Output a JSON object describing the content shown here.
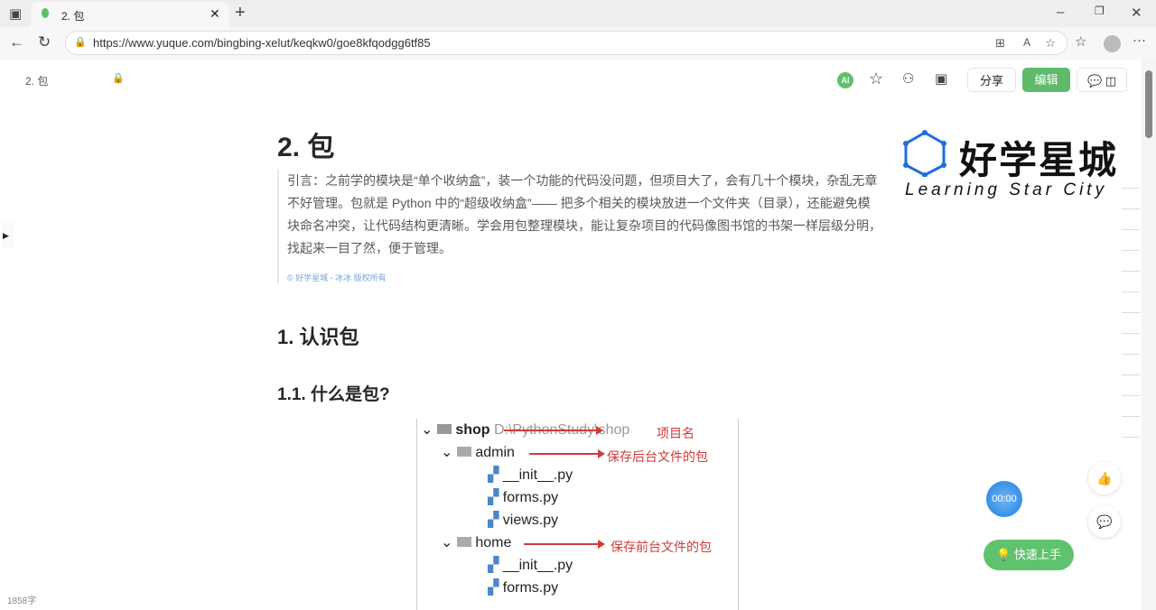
{
  "browser": {
    "tab_title": "2. 包",
    "url": "https://www.yuque.com/bingbing-xelut/keqkw0/goe8kfqodgg6tf85"
  },
  "doc_header": {
    "title": "2. 包",
    "ai_label": "AI",
    "share": "分享",
    "edit": "编辑"
  },
  "logo": {
    "cn": "好学星城",
    "en": "Learning Star City"
  },
  "article": {
    "title": "2. 包",
    "quote": "引言：之前学的模块是“单个收纳盒”，装一个功能的代码没问题，但项目大了，会有几十个模块，杂乱无章不好管理。包就是 Python 中的“超级收纳盒”—— 把多个相关的模块放进一个文件夹（目录），还能避免模块命名冲突，让代码结构更清晰。学会用包整理模块，能让复杂项目的代码像图书馆的书架一样层级分明，找起来一目了然，便于管理。",
    "copyright": "© 好学星城 - 冰冰 版权所有",
    "h2": "1. 认识包",
    "h3": "1.1. 什么是包?"
  },
  "tree": {
    "root": "shop",
    "root_path": "D:\\PythonStudy\\shop",
    "root_note": "项目名",
    "admin": "admin",
    "admin_note": "保存后台文件的包",
    "admin_files": [
      "__init__.py",
      "forms.py",
      "views.py"
    ],
    "home": "home",
    "home_note": "保存前台文件的包",
    "home_files": [
      "__init__.py",
      "forms.py"
    ]
  },
  "widgets": {
    "timer": "00:00",
    "quick_start": "快速上手",
    "word_count": "1858字"
  }
}
